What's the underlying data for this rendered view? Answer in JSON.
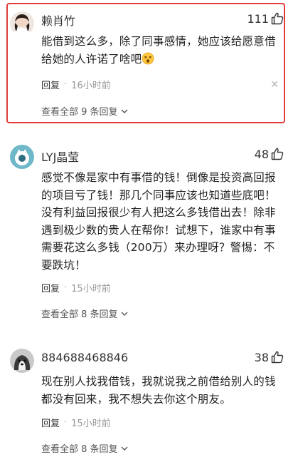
{
  "comments": [
    {
      "username": "赖肖竹",
      "likes": "111",
      "body": "能借到这么多，除了同事感情，她应该给愿意借给她的人许诺了啥吧",
      "emoji": "dizzy-face-emoji",
      "reply_label": "回复",
      "dot": "·",
      "time": "16小时前",
      "close": "✕",
      "view_all": "查看全部 9 条回复"
    },
    {
      "username": "LYJ晶莹",
      "likes": "48",
      "body": "感觉不像是家中有事借的钱！倒像是投资高回报的项目亏了钱！那几个同事应该也知道些底吧！没有利益回报很少有人把这么多钱借出去！除非遇到极少数的贵人在帮你！试想下，谁家中有事需要花这么多钱（200万）来办理呀？警惕：不要跌坑！",
      "reply_label": "回复",
      "dot": "·",
      "time": "15小时前",
      "view_all": "查看全部 8 条回复"
    },
    {
      "username": "884688468846",
      "likes": "38",
      "body": "现在别人找我借钱，我就说我之前借给别人的钱都没有回来，我不想失去你这个朋友。",
      "reply_label": "回复",
      "dot": "·",
      "time": "15小时前",
      "view_all": "查看全部 8 条回复"
    }
  ],
  "colors": {
    "highlight_border": "#e23b3b",
    "meta_text": "#999999",
    "body_text": "#222222"
  },
  "icons": {
    "like": "thumbs-up-icon",
    "expand": "chevron-down-icon",
    "dismiss": "close-icon"
  }
}
